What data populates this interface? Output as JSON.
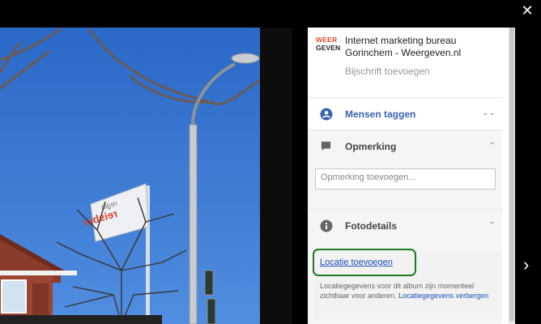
{
  "viewer": {
    "close_icon": "close-icon",
    "next_icon": "chevron-right-icon"
  },
  "info_panel": {
    "logo": {
      "line1": "WEER",
      "line2": "GEVEN",
      "colors": {
        "line1": "#e44b23",
        "line2": "#222222"
      }
    },
    "author": "Internet marketing bureau Gorinchem - Weergeven.nl",
    "caption_placeholder": "Bijschrift toevoegen",
    "tag_people": {
      "label": "Mensen taggen",
      "icon": "person-circle-icon",
      "color": "#3b62b0"
    },
    "comment": {
      "label": "Opmerking",
      "icon": "comment-icon",
      "placeholder": "Opmerking toevoegen..."
    },
    "photo_details": {
      "label": "Fotodetails",
      "icon": "info-icon",
      "location_link": "Locatie toevoegen",
      "location_info": "Locatiegegevens voor dit album zijn momenteel zichtbaar voor anderen.",
      "location_hide_link": "Locatiegegevens verbergen"
    }
  }
}
